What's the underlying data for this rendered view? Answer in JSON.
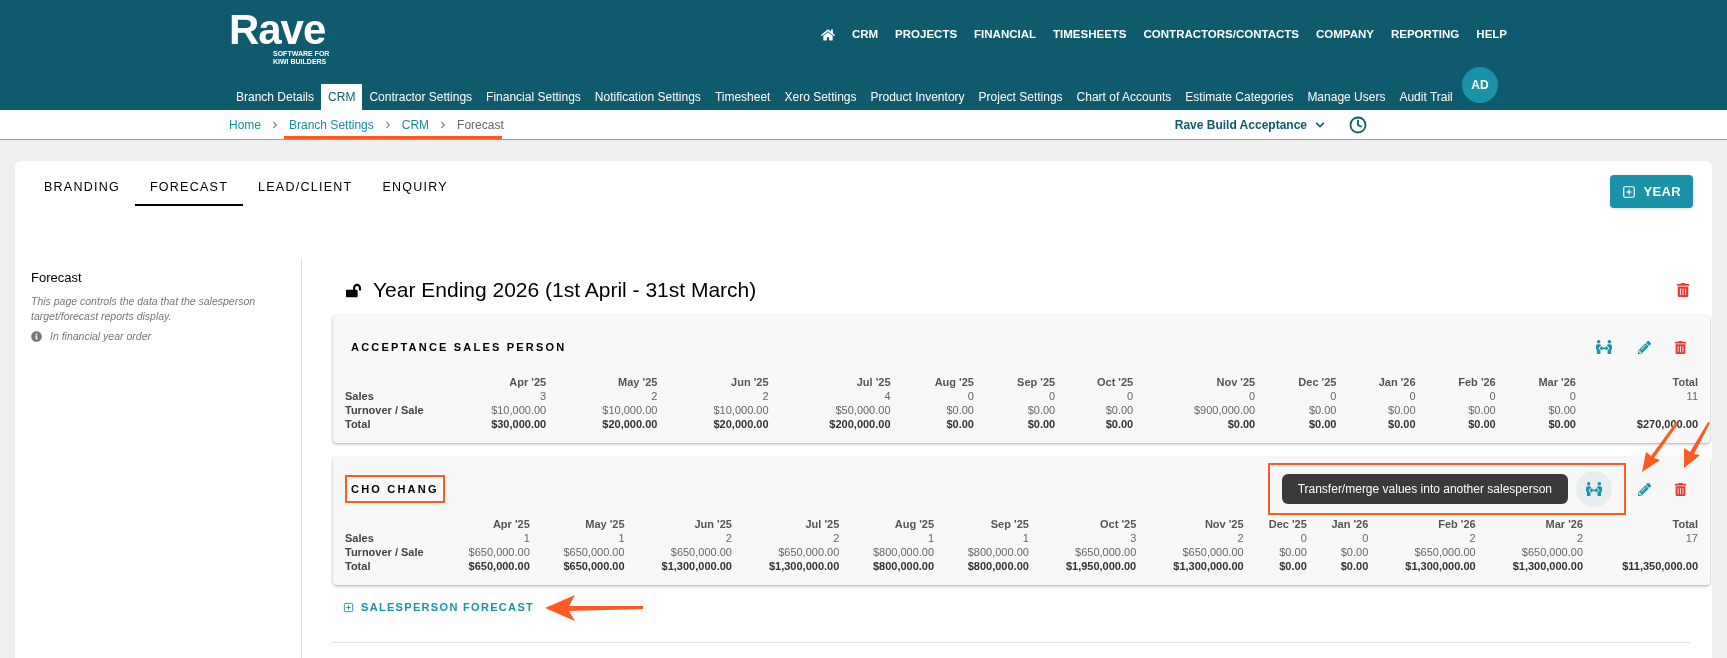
{
  "header": {
    "logo": "Rave",
    "logo_tagline": "SOFTWARE FOR KIWI BUILDERS",
    "nav": [
      "CRM",
      "PROJECTS",
      "FINANCIAL",
      "TIMESHEETS",
      "CONTRACTORS/CONTACTS",
      "COMPANY",
      "REPORTING",
      "HELP"
    ],
    "avatar": "AD"
  },
  "settings_tabs": [
    {
      "label": "Branch Details",
      "selected": false
    },
    {
      "label": "CRM",
      "selected": true
    },
    {
      "label": "Contractor Settings",
      "selected": false
    },
    {
      "label": "Financial Settings",
      "selected": false
    },
    {
      "label": "Notification Settings",
      "selected": false
    },
    {
      "label": "Timesheet",
      "selected": false
    },
    {
      "label": "Xero Settings",
      "selected": false
    },
    {
      "label": "Product Inventory",
      "selected": false
    },
    {
      "label": "Project Settings",
      "selected": false
    },
    {
      "label": "Chart of Accounts",
      "selected": false
    },
    {
      "label": "Estimate Categories",
      "selected": false
    },
    {
      "label": "Manage Users",
      "selected": false
    },
    {
      "label": "Audit Trail",
      "selected": false
    }
  ],
  "breadcrumb": [
    "Home",
    "Branch Settings",
    "CRM",
    "Forecast"
  ],
  "branch_selector": "Rave Build Acceptance",
  "page_tabs": [
    {
      "label": "BRANDING",
      "selected": false
    },
    {
      "label": "FORECAST",
      "selected": true
    },
    {
      "label": "LEAD/CLIENT",
      "selected": false
    },
    {
      "label": "ENQUIRY",
      "selected": false
    }
  ],
  "add_year_button": "YEAR",
  "sidebar": {
    "title": "Forecast",
    "description": "This page controls the data that the salesperson target/forecast reports display.",
    "note": "In financial year order"
  },
  "year": {
    "title": "Year Ending 2026 (1st April - 31st March)",
    "locked": false
  },
  "forecasts": [
    {
      "name": "ACCEPTANCE SALES PERSON",
      "highlighted": false,
      "columns": [
        "Apr '25",
        "May '25",
        "Jun '25",
        "Jul '25",
        "Aug '25",
        "Sep '25",
        "Oct '25",
        "Nov '25",
        "Dec '25",
        "Jan '26",
        "Feb '26",
        "Mar '26",
        "Total"
      ],
      "rows": [
        {
          "label": "Sales",
          "bold": false,
          "values": [
            "3",
            "2",
            "2",
            "4",
            "0",
            "0",
            "0",
            "0",
            "0",
            "0",
            "0",
            "0",
            "11"
          ]
        },
        {
          "label": "Turnover / Sale",
          "bold": false,
          "values": [
            "$10,000.00",
            "$10,000.00",
            "$10,000.00",
            "$50,000.00",
            "$0.00",
            "$0.00",
            "$0.00",
            "$900,000.00",
            "$0.00",
            "$0.00",
            "$0.00",
            "$0.00"
          ]
        },
        {
          "label": "Total",
          "bold": true,
          "values": [
            "$30,000.00",
            "$20,000.00",
            "$20,000.00",
            "$200,000.00",
            "$0.00",
            "$0.00",
            "$0.00",
            "$0.00",
            "$0.00",
            "$0.00",
            "$0.00",
            "$0.00",
            "$270,000.00"
          ]
        }
      ]
    },
    {
      "name": "CHO CHANG",
      "highlighted": true,
      "tooltip": "Transfer/merge values into another salesperson",
      "columns": [
        "Apr '25",
        "May '25",
        "Jun '25",
        "Jul '25",
        "Aug '25",
        "Sep '25",
        "Oct '25",
        "Nov '25",
        "Dec '25",
        "Jan '26",
        "Feb '26",
        "Mar '26",
        "Total"
      ],
      "rows": [
        {
          "label": "Sales",
          "bold": false,
          "values": [
            "1",
            "1",
            "2",
            "2",
            "1",
            "1",
            "3",
            "2",
            "0",
            "0",
            "2",
            "2",
            "17"
          ]
        },
        {
          "label": "Turnover / Sale",
          "bold": false,
          "values": [
            "$650,000.00",
            "$650,000.00",
            "$650,000.00",
            "$650,000.00",
            "$800,000.00",
            "$800,000.00",
            "$650,000.00",
            "$650,000.00",
            "$0.00",
            "$0.00",
            "$650,000.00",
            "$650,000.00"
          ]
        },
        {
          "label": "Total",
          "bold": true,
          "values": [
            "$650,000.00",
            "$650,000.00",
            "$1,300,000.00",
            "$1,300,000.00",
            "$800,000.00",
            "$800,000.00",
            "$1,950,000.00",
            "$1,300,000.00",
            "$0.00",
            "$0.00",
            "$1,300,000.00",
            "$1,300,000.00",
            "$11,350,000.00"
          ]
        }
      ]
    }
  ],
  "add_salesperson_button": "SALESPERSON FORECAST"
}
